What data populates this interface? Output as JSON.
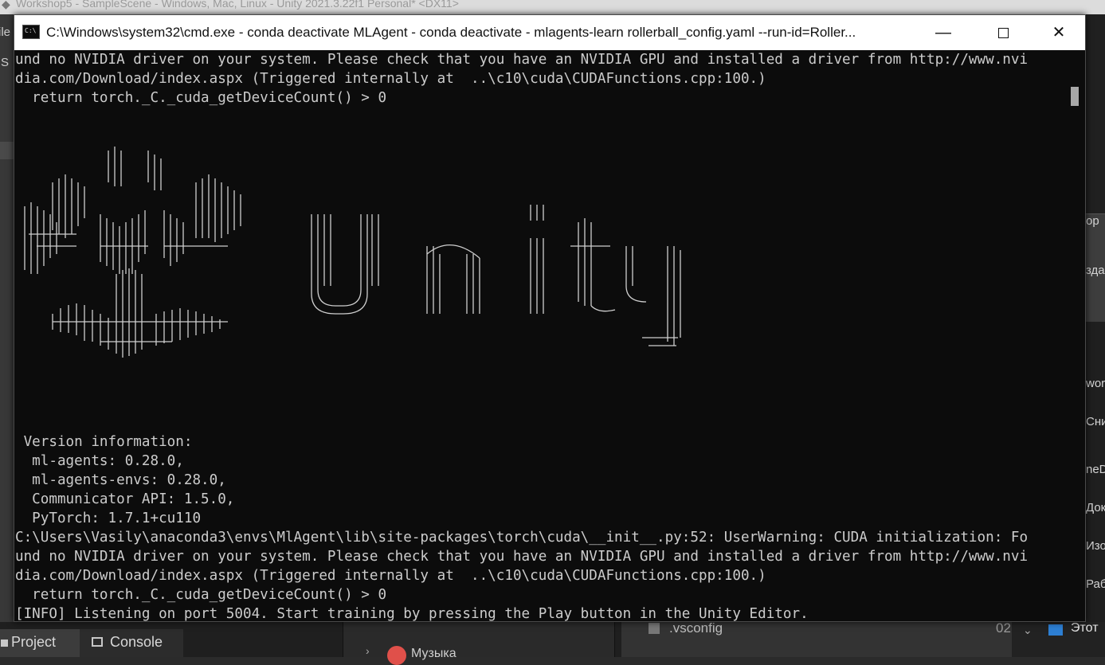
{
  "background_editor": {
    "title": "Workshop5 - SampleScene - Windows, Mac, Linux - Unity 2021.3.22f1 Personal* <DX11>",
    "left_partial_1": "ile",
    "left_partial_2": "S",
    "right_items": [
      "ор",
      "зда",
      "wor",
      "Сни",
      "neD",
      "Док",
      "Изо",
      "Раб"
    ],
    "bottom_tabs": {
      "project": "Project",
      "console": "Console"
    },
    "explorer_music": "Музыка",
    "vsconfig": ".vsconfig",
    "vsconfig_date_partial": "02",
    "this_pc_partial": "Этот"
  },
  "cmd_window": {
    "title": "C:\\Windows\\system32\\cmd.exe - conda  deactivate MLAgent - conda  deactivate - mlagents-learn  rollerball_config.yaml --run-id=Roller...",
    "icon": "cmd-icon",
    "controls": {
      "minimize": "—",
      "maximize": "",
      "close": "✕"
    }
  },
  "terminal_lines_top": [
    "und no NVIDIA driver on your system. Please check that you have an NVIDIA GPU and installed a driver from http://www.nvi",
    "dia.com/Download/index.aspx (Triggered internally at  ..\\c10\\cuda\\CUDAFunctions.cpp:100.)",
    "  return torch._C._cuda_getDeviceCount() > 0"
  ],
  "terminal_lines_bottom": [
    " Version information:",
    "  ml-agents: 0.28.0,",
    "  ml-agents-envs: 0.28.0,",
    "  Communicator API: 1.5.0,",
    "  PyTorch: 1.7.1+cu110",
    "C:\\Users\\Vasily\\anaconda3\\envs\\MlAgent\\lib\\site-packages\\torch\\cuda\\__init__.py:52: UserWarning: CUDA initialization: Fo",
    "und no NVIDIA driver on your system. Please check that you have an NVIDIA GPU and installed a driver from http://www.nvi",
    "dia.com/Download/index.aspx (Triggered internally at  ..\\c10\\cuda\\CUDAFunctions.cpp:100.)",
    "  return torch._C._cuda_getDeviceCount() > 0",
    "[INFO] Listening on port 5004. Start training by pressing the Play button in the Unity Editor."
  ],
  "ascii_logo_text": "Unity",
  "colors": {
    "terminal_bg": "#0c0c0c",
    "terminal_fg": "#cccccc",
    "titlebar_bg": "#ffffff",
    "scroll_thumb": "#a8a8a8"
  }
}
